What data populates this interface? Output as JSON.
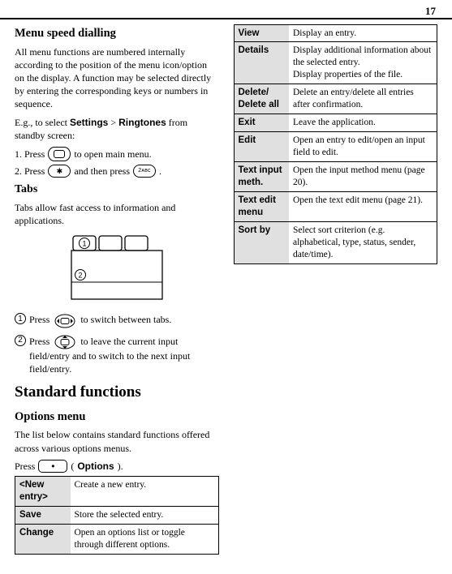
{
  "page_number": "17",
  "left": {
    "h_speed": "Menu speed dialling",
    "p1": "All menu functions are numbered internally according to the position of the menu icon/option on the display. A function may be selected directly by entering the corresponding keys or numbers in sequence.",
    "eg_prefix": "E.g., to select ",
    "eg_settings": "Settings",
    "eg_gt": " > ",
    "eg_ring": "Ringtones",
    "eg_suffix": " from standby screen:",
    "step1_a": "1. Press ",
    "step1_b": " to open main menu.",
    "step2_a": "2. Press ",
    "step2_b": " and then press ",
    "step2_c": ".",
    "h_tabs": "Tabs",
    "tabs_p": "Tabs allow fast access to information and applications.",
    "note1": "Press             to switch between tabs.",
    "note2": "Press             to leave the current input field/entry and to switch to the next input field/entry."
  },
  "right": {
    "h_std": "Standard functions",
    "h_opt": "Options menu",
    "opt_p": "The list below contains standard functions offered across various options menus.",
    "press": "Press ",
    "press_paren_open": " (",
    "press_options": "Options",
    "press_paren_close": ").",
    "rows": [
      {
        "k": "<New entry>",
        "v": "Create a new entry."
      },
      {
        "k": "Save",
        "v": "Store the selected entry."
      },
      {
        "k": "Change",
        "v": "Open an options list or toggle through different options."
      },
      {
        "k": "View",
        "v": "Display an entry."
      },
      {
        "k": "Details",
        "v": "Display additional information about the selected entry.\nDisplay properties of the file."
      },
      {
        "k": "Delete/ Delete all",
        "v": "Delete an entry/delete all entries after confirmation."
      },
      {
        "k": "Exit",
        "v": "Leave the application."
      },
      {
        "k": "Edit",
        "v": "Open an entry to edit/open an input field to edit."
      },
      {
        "k": "Text input meth.",
        "v": "Open the input method menu (page 20)."
      },
      {
        "k": "Text edit menu",
        "v": "Open the text edit menu (page 21)."
      },
      {
        "k": "Sort by",
        "v": "Select sort criterion (e.g. alphabetical, type, status, sender, date/time)."
      }
    ]
  }
}
